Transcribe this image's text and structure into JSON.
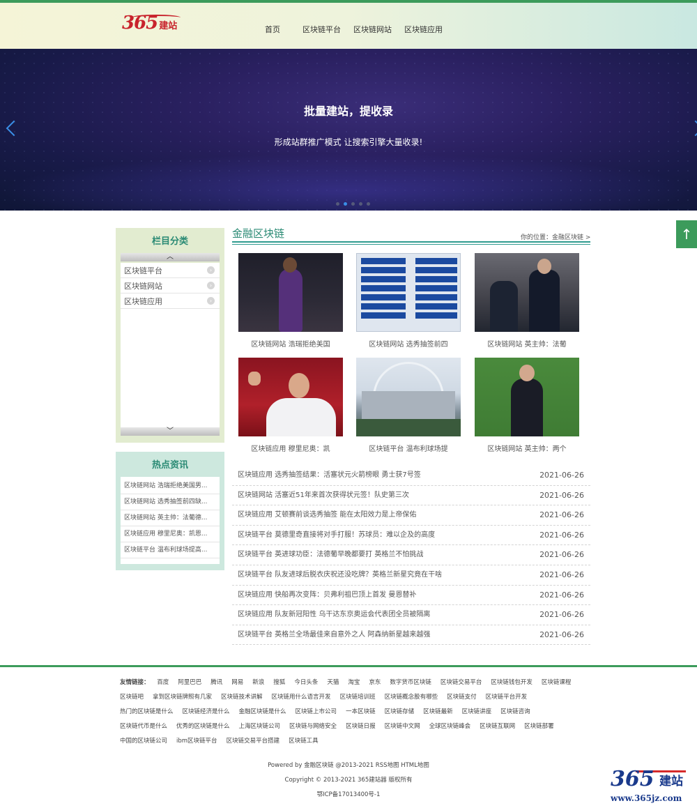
{
  "header": {
    "logo_num": "365",
    "logo_text": "建站",
    "nav": [
      "首页",
      "区块链平台",
      "区块链网站",
      "区块链应用"
    ]
  },
  "banner": {
    "title": "批量建站，提收录",
    "subtitle": "形成站群推广模式 让搜索引擎大量收录!",
    "slides": 5,
    "active_slide": 2
  },
  "back_to_top": "↑",
  "sidebar": {
    "category_title": "栏目分类",
    "scroll_up": "︿",
    "scroll_down": "﹀",
    "categories": [
      "区块链平台",
      "区块链网站",
      "区块链应用"
    ],
    "hot_title": "热点资讯",
    "hot": [
      "区块链网站 浩瑞拒绝美国男...",
      "区块链网站 选秀抽签前四缺...",
      "区块链网站 英主帅：法葡德...",
      "区块链应用 穆里尼奥：凯恩...",
      "区块链平台 温布利球场提高..."
    ]
  },
  "main": {
    "title": "金融区块链",
    "breadcrumb": "你的位置：金融区块链 >",
    "thumbs": [
      "区块链网站 浩瑞拒绝美国",
      "区块链网站 选秀抽签前四",
      "区块链网站 英主帅：法葡",
      "区块链应用 穆里尼奥：凯",
      "区块链平台 温布利球场提",
      "区块链网站 英主帅：两个"
    ],
    "news": [
      {
        "title": "区块链应用 选秀抽签结果：活塞状元火箭榜眼 勇士获7号签",
        "date": "2021-06-26"
      },
      {
        "title": "区块链网站 活塞近51年来首次获得状元签！队史第三次",
        "date": "2021-06-26"
      },
      {
        "title": "区块链应用 艾顿赛前谈选秀抽签 能在太阳效力是上帝保佑",
        "date": "2021-06-26"
      },
      {
        "title": "区块链平台 莫德里奇直接将对手打服！苏球员：难以企及的高度",
        "date": "2021-06-26"
      },
      {
        "title": "区块链平台 英进球功臣：法德葡早晚都要打 英格兰不怕挑战",
        "date": "2021-06-26"
      },
      {
        "title": "区块链平台 队友进球后脱衣庆祝还没吃牌？英格兰新星究竟在干啥",
        "date": "2021-06-26"
      },
      {
        "title": "区块链应用 快船再次变阵：贝弗利祖巴顶上首发 曼恩替补",
        "date": "2021-06-26"
      },
      {
        "title": "区块链应用 队友新冠阳性 乌干达东京奥运会代表团全员被隔离",
        "date": "2021-06-26"
      },
      {
        "title": "区块链平台 英格兰全场最佳来自意外之人 阿森纳新星越来越强",
        "date": "2021-06-26"
      }
    ]
  },
  "footer": {
    "links_label": "友情链接：",
    "links": [
      "百度",
      "阿里巴巴",
      "腾讯",
      "网易",
      "新浪",
      "搜狐",
      "今日头条",
      "天猫",
      "淘宝",
      "京东",
      "数字货币区块链",
      "区块链交易平台",
      "区块链钱包开发",
      "区块链课程",
      "区块链吧",
      "拿到区块链牌照有几家",
      "区块链技术讲解",
      "区块链用什么语言开发",
      "区块链培训班",
      "区块链概念股有哪些",
      "区块链支付",
      "区块链平台开发",
      "热门的区块链是什么",
      "区块链经济是什么",
      "金融区块链是什么",
      "区块链上市公司",
      "一本区块链",
      "区块链存储",
      "区块链最新",
      "区块链讲座",
      "区块链咨询",
      "区块链代币是什么",
      "优秀的区块链是什么",
      "上海区块链公司",
      "区块链与网络安全",
      "区块链日报",
      "区块链中文网",
      "全球区块链峰会",
      "区块链互联网",
      "区块链部署",
      "中国的区块链公司",
      "ibm区块链平台",
      "区块链交易平台搭建",
      "区块链工具"
    ],
    "powered": "Powered by 金融区块链 @2013-2021 RSS地图 HTML地图",
    "copyright": "Copyright © 2013-2021 365建站器 版权所有",
    "icp": "鄂ICP备17013400号-1"
  },
  "watermark": {
    "num": "365",
    "text": "建站",
    "url": "www.365jz.com"
  }
}
